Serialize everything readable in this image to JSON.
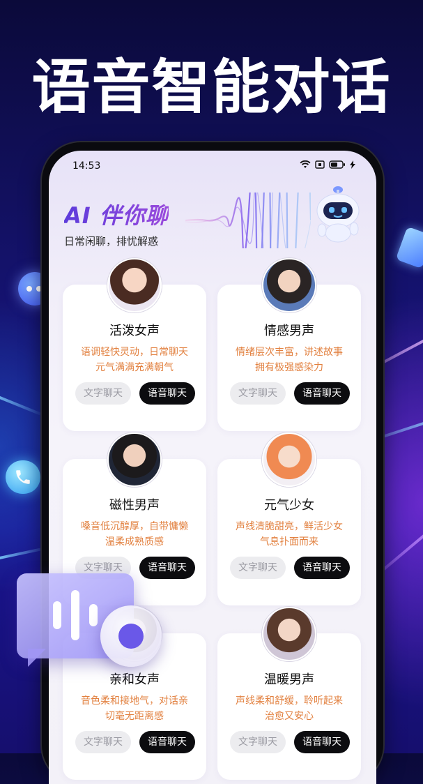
{
  "headline": "语音智能对话",
  "status_bar": {
    "time": "14:53"
  },
  "header": {
    "brand": "AI 伴你聊",
    "tagline": "日常闲聊，排忧解惑"
  },
  "buttons": {
    "text_chat": "文字聊天",
    "voice_chat": "语音聊天"
  },
  "cards": [
    {
      "name": "活泼女声",
      "desc_line1": "语调轻快灵动，日常聊天",
      "desc_line2": "元气满满充满朝气"
    },
    {
      "name": "情感男声",
      "desc_line1": "情绪层次丰富，讲述故事",
      "desc_line2": "拥有极强感染力"
    },
    {
      "name": "磁性男声",
      "desc_line1": "嗓音低沉醇厚，自带慵懒",
      "desc_line2": "温柔成熟质感"
    },
    {
      "name": "元气少女",
      "desc_line1": "声线清脆甜亮，鲜活少女",
      "desc_line2": "气息扑面而来"
    },
    {
      "name": "亲和女声",
      "desc_line1": "音色柔和接地气，对话亲",
      "desc_line2": "切毫无距离感"
    },
    {
      "name": "温暖男声",
      "desc_line1": "声线柔和舒缓，聆听起来",
      "desc_line2": "治愈又安心"
    }
  ],
  "colors": {
    "accent_purple": "#6a3ee0",
    "desc_orange": "#e2803f",
    "voice_btn": "#0c0c0f"
  }
}
